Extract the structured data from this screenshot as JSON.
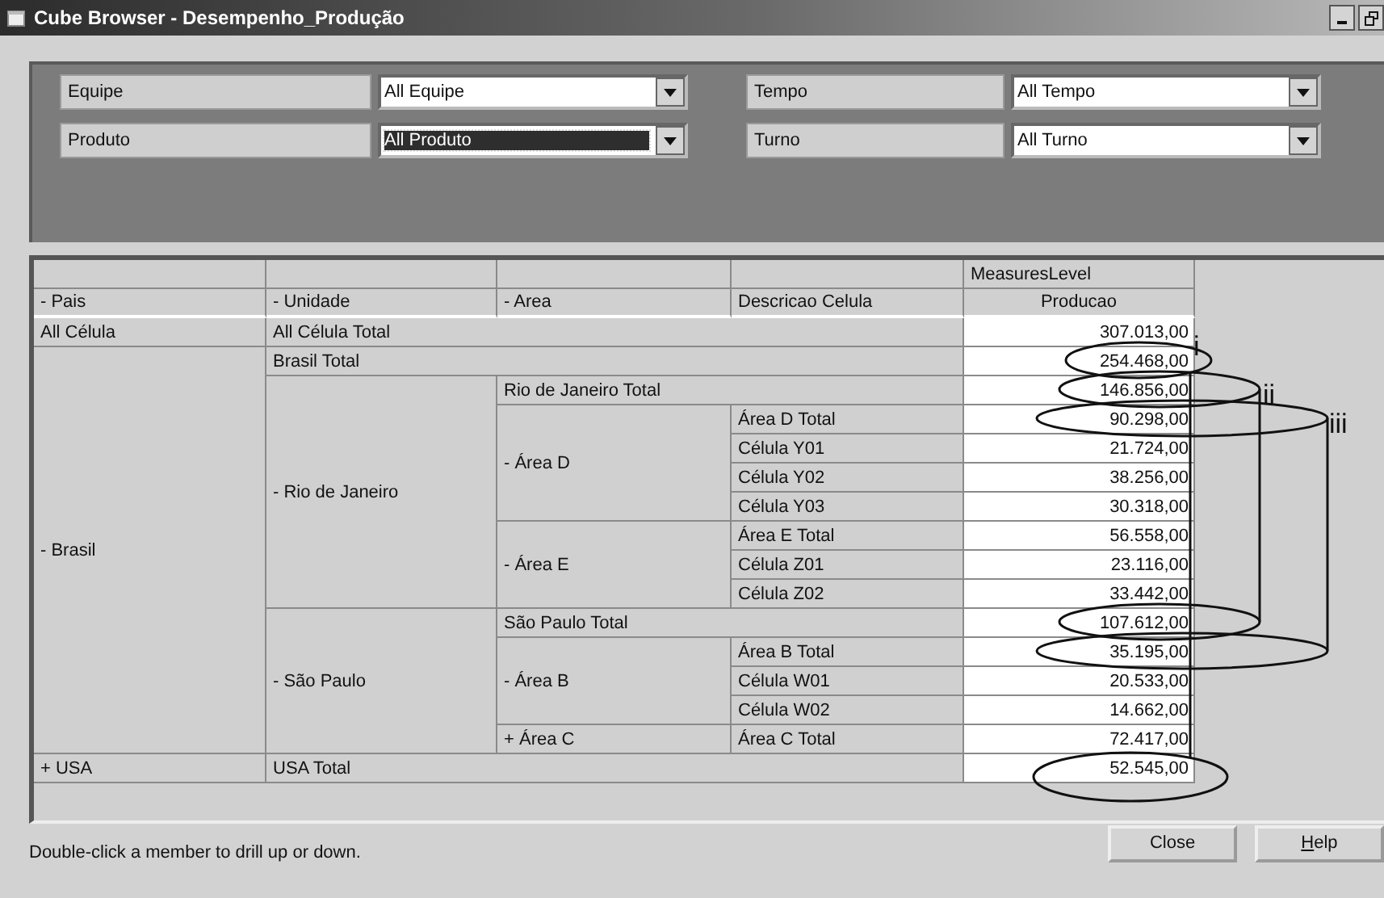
{
  "window": {
    "title": "Cube Browser - Desempenho_Produção"
  },
  "filters": [
    {
      "label": "Equipe",
      "value": "All Equipe",
      "selected": false
    },
    {
      "label": "Tempo",
      "value": "All Tempo",
      "selected": false
    },
    {
      "label": "Produto",
      "value": "All Produto",
      "selected": true
    },
    {
      "label": "Turno",
      "value": "All Turno",
      "selected": false
    }
  ],
  "pivot": {
    "measures_level": "MeasuresLevel",
    "measure": "Producao",
    "columns": [
      "- Pais",
      "- Unidade",
      "- Area",
      "Descricao Celula"
    ],
    "rows": [
      {
        "label": "All Célula",
        "total": "All Célula Total",
        "value": "307.013,00"
      },
      {
        "label": "- Brasil",
        "total": "Brasil Total",
        "value": "254.468,00",
        "children": [
          {
            "label": "- Rio de Janeiro",
            "total": "Rio de Janeiro Total",
            "value": "146.856,00",
            "children": [
              {
                "label": "- Área D",
                "total": "Área D Total",
                "value": "90.298,00",
                "children": [
                  {
                    "label": "Célula Y01",
                    "value": "21.724,00"
                  },
                  {
                    "label": "Célula Y02",
                    "value": "38.256,00"
                  },
                  {
                    "label": "Célula Y03",
                    "value": "30.318,00"
                  }
                ]
              },
              {
                "label": "- Área E",
                "total": "Área E Total",
                "value": "56.558,00",
                "children": [
                  {
                    "label": "Célula Z01",
                    "value": "23.116,00"
                  },
                  {
                    "label": "Célula Z02",
                    "value": "33.442,00"
                  }
                ]
              }
            ]
          },
          {
            "label": "- São Paulo",
            "total": "São Paulo Total",
            "value": "107.612,00",
            "children": [
              {
                "label": "- Área B",
                "total": "Área B Total",
                "value": "35.195,00",
                "children": [
                  {
                    "label": "Célula W01",
                    "value": "20.533,00"
                  },
                  {
                    "label": "Célula W02",
                    "value": "14.662,00"
                  }
                ]
              },
              {
                "label": "+ Área C",
                "total": "Área C Total",
                "value": "72.417,00"
              }
            ]
          }
        ]
      },
      {
        "label": "+ USA",
        "total": "USA Total",
        "value": "52.545,00"
      }
    ]
  },
  "annotations": [
    {
      "label": "i"
    },
    {
      "label": "ii"
    },
    {
      "label": "iii"
    }
  ],
  "status_bar": "Double-click a member to drill up or down.",
  "buttons": [
    {
      "label": "Close"
    },
    {
      "label": "Help",
      "mnemonic": true
    }
  ]
}
